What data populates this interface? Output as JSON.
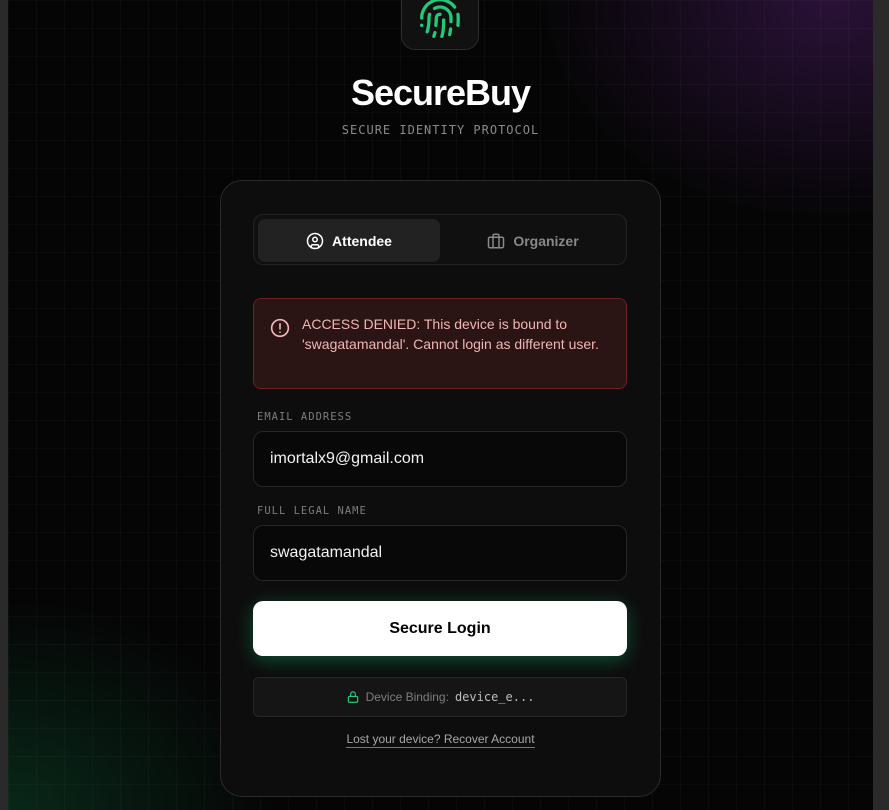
{
  "brand": {
    "name": "SecureBuy",
    "tagline": "SECURE IDENTITY PROTOCOL",
    "logo_icon": "fingerprint-icon",
    "accent_color": "#22c97a"
  },
  "tabs": [
    {
      "label": "Attendee",
      "icon": "user-circle-icon",
      "active": true
    },
    {
      "label": "Organizer",
      "icon": "briefcase-icon",
      "active": false
    }
  ],
  "alert": {
    "icon": "alert-circle-icon",
    "message": "ACCESS DENIED: This device is bound to 'swagatamandal'. Cannot login as different user.",
    "color": "#f1b5b5"
  },
  "form": {
    "email": {
      "label": "EMAIL ADDRESS",
      "value": "imortalx9@gmail.com"
    },
    "name": {
      "label": "FULL LEGAL NAME",
      "value": "swagatamandal"
    },
    "submit_label": "Secure Login"
  },
  "device_binding": {
    "icon": "lock-icon",
    "label": "Device Binding:",
    "value": "device_e..."
  },
  "recover_link": "Lost your device? Recover Account"
}
